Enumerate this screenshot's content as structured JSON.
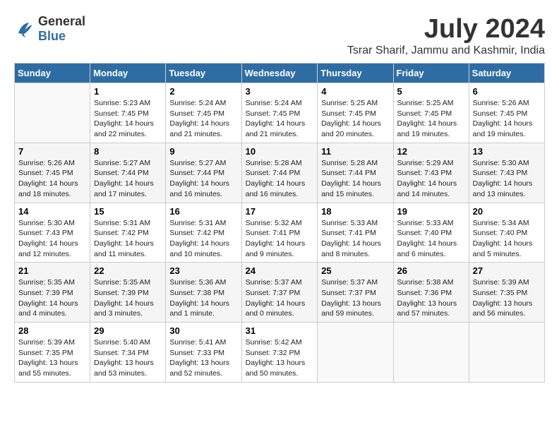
{
  "logo": {
    "line1": "General",
    "line2": "Blue"
  },
  "title": "July 2024",
  "location": "Tsrar Sharif, Jammu and Kashmir, India",
  "days_header": [
    "Sunday",
    "Monday",
    "Tuesday",
    "Wednesday",
    "Thursday",
    "Friday",
    "Saturday"
  ],
  "weeks": [
    [
      {
        "day": "",
        "info": ""
      },
      {
        "day": "1",
        "info": "Sunrise: 5:23 AM\nSunset: 7:45 PM\nDaylight: 14 hours\nand 22 minutes."
      },
      {
        "day": "2",
        "info": "Sunrise: 5:24 AM\nSunset: 7:45 PM\nDaylight: 14 hours\nand 21 minutes."
      },
      {
        "day": "3",
        "info": "Sunrise: 5:24 AM\nSunset: 7:45 PM\nDaylight: 14 hours\nand 21 minutes."
      },
      {
        "day": "4",
        "info": "Sunrise: 5:25 AM\nSunset: 7:45 PM\nDaylight: 14 hours\nand 20 minutes."
      },
      {
        "day": "5",
        "info": "Sunrise: 5:25 AM\nSunset: 7:45 PM\nDaylight: 14 hours\nand 19 minutes."
      },
      {
        "day": "6",
        "info": "Sunrise: 5:26 AM\nSunset: 7:45 PM\nDaylight: 14 hours\nand 19 minutes."
      }
    ],
    [
      {
        "day": "7",
        "info": "Sunrise: 5:26 AM\nSunset: 7:45 PM\nDaylight: 14 hours\nand 18 minutes."
      },
      {
        "day": "8",
        "info": "Sunrise: 5:27 AM\nSunset: 7:44 PM\nDaylight: 14 hours\nand 17 minutes."
      },
      {
        "day": "9",
        "info": "Sunrise: 5:27 AM\nSunset: 7:44 PM\nDaylight: 14 hours\nand 16 minutes."
      },
      {
        "day": "10",
        "info": "Sunrise: 5:28 AM\nSunset: 7:44 PM\nDaylight: 14 hours\nand 16 minutes."
      },
      {
        "day": "11",
        "info": "Sunrise: 5:28 AM\nSunset: 7:44 PM\nDaylight: 14 hours\nand 15 minutes."
      },
      {
        "day": "12",
        "info": "Sunrise: 5:29 AM\nSunset: 7:43 PM\nDaylight: 14 hours\nand 14 minutes."
      },
      {
        "day": "13",
        "info": "Sunrise: 5:30 AM\nSunset: 7:43 PM\nDaylight: 14 hours\nand 13 minutes."
      }
    ],
    [
      {
        "day": "14",
        "info": "Sunrise: 5:30 AM\nSunset: 7:43 PM\nDaylight: 14 hours\nand 12 minutes."
      },
      {
        "day": "15",
        "info": "Sunrise: 5:31 AM\nSunset: 7:42 PM\nDaylight: 14 hours\nand 11 minutes."
      },
      {
        "day": "16",
        "info": "Sunrise: 5:31 AM\nSunset: 7:42 PM\nDaylight: 14 hours\nand 10 minutes."
      },
      {
        "day": "17",
        "info": "Sunrise: 5:32 AM\nSunset: 7:41 PM\nDaylight: 14 hours\nand 9 minutes."
      },
      {
        "day": "18",
        "info": "Sunrise: 5:33 AM\nSunset: 7:41 PM\nDaylight: 14 hours\nand 8 minutes."
      },
      {
        "day": "19",
        "info": "Sunrise: 5:33 AM\nSunset: 7:40 PM\nDaylight: 14 hours\nand 6 minutes."
      },
      {
        "day": "20",
        "info": "Sunrise: 5:34 AM\nSunset: 7:40 PM\nDaylight: 14 hours\nand 5 minutes."
      }
    ],
    [
      {
        "day": "21",
        "info": "Sunrise: 5:35 AM\nSunset: 7:39 PM\nDaylight: 14 hours\nand 4 minutes."
      },
      {
        "day": "22",
        "info": "Sunrise: 5:35 AM\nSunset: 7:39 PM\nDaylight: 14 hours\nand 3 minutes."
      },
      {
        "day": "23",
        "info": "Sunrise: 5:36 AM\nSunset: 7:38 PM\nDaylight: 14 hours\nand 1 minute."
      },
      {
        "day": "24",
        "info": "Sunrise: 5:37 AM\nSunset: 7:37 PM\nDaylight: 14 hours\nand 0 minutes."
      },
      {
        "day": "25",
        "info": "Sunrise: 5:37 AM\nSunset: 7:37 PM\nDaylight: 13 hours\nand 59 minutes."
      },
      {
        "day": "26",
        "info": "Sunrise: 5:38 AM\nSunset: 7:36 PM\nDaylight: 13 hours\nand 57 minutes."
      },
      {
        "day": "27",
        "info": "Sunrise: 5:39 AM\nSunset: 7:35 PM\nDaylight: 13 hours\nand 56 minutes."
      }
    ],
    [
      {
        "day": "28",
        "info": "Sunrise: 5:39 AM\nSunset: 7:35 PM\nDaylight: 13 hours\nand 55 minutes."
      },
      {
        "day": "29",
        "info": "Sunrise: 5:40 AM\nSunset: 7:34 PM\nDaylight: 13 hours\nand 53 minutes."
      },
      {
        "day": "30",
        "info": "Sunrise: 5:41 AM\nSunset: 7:33 PM\nDaylight: 13 hours\nand 52 minutes."
      },
      {
        "day": "31",
        "info": "Sunrise: 5:42 AM\nSunset: 7:32 PM\nDaylight: 13 hours\nand 50 minutes."
      },
      {
        "day": "",
        "info": ""
      },
      {
        "day": "",
        "info": ""
      },
      {
        "day": "",
        "info": ""
      }
    ]
  ]
}
